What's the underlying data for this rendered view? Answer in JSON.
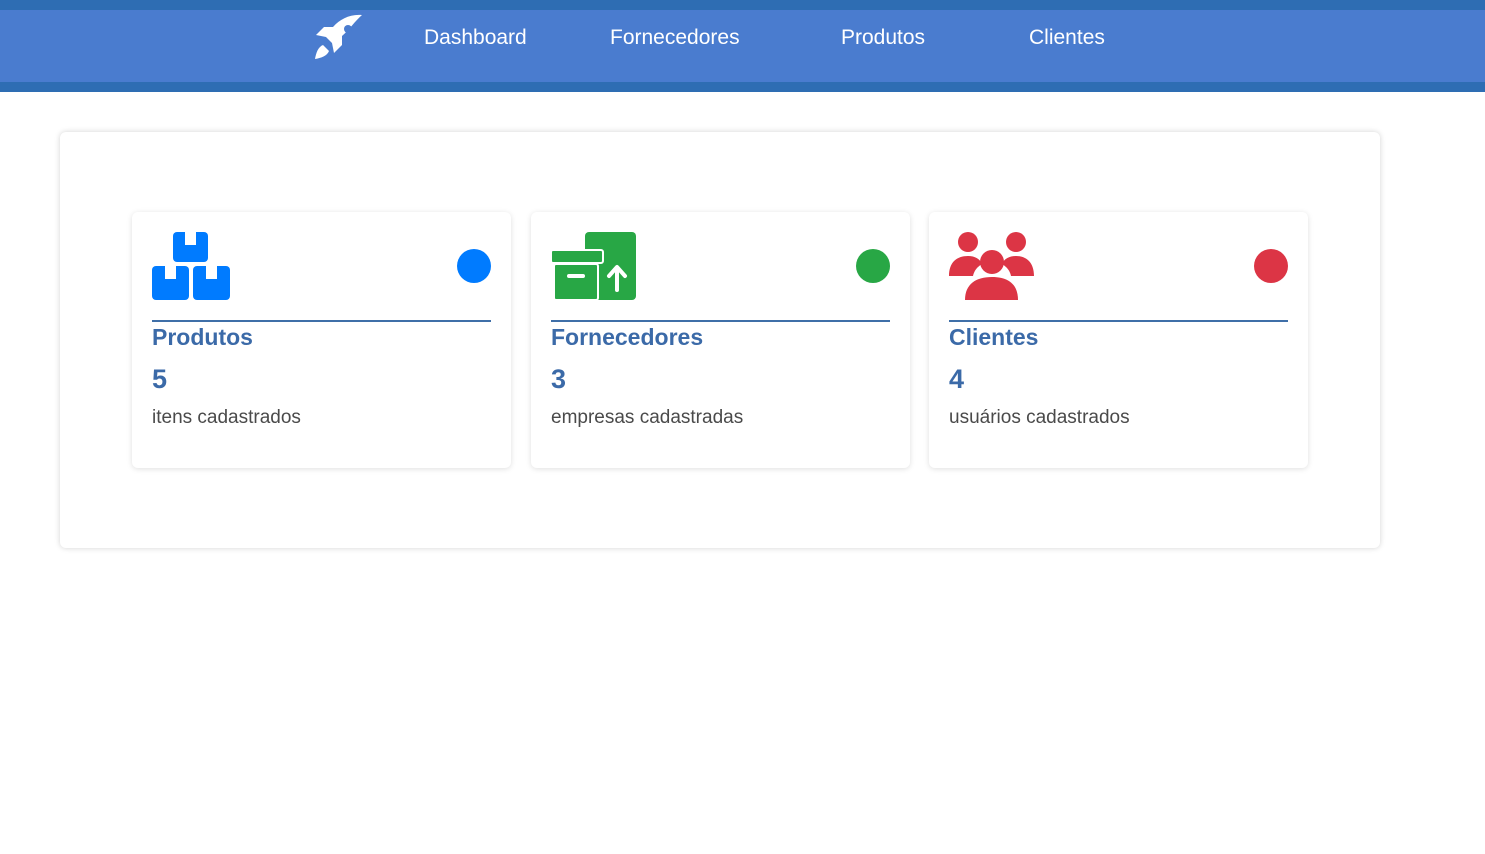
{
  "nav": {
    "logo_icon": "rocket-icon",
    "links": [
      {
        "label": "Dashboard"
      },
      {
        "label": "Fornecedores"
      },
      {
        "label": "Produtos"
      },
      {
        "label": "Clientes"
      }
    ]
  },
  "colors": {
    "navbar": "#4a7ccf",
    "navbar_border": "#2e6db3",
    "title": "#3b6aa8",
    "blue": "#007bff",
    "green": "#28a745",
    "red": "#dc3545"
  },
  "cards": [
    {
      "icon": "boxes-icon",
      "title": "Produtos",
      "count": "5",
      "description": "itens cadastrados",
      "color": "#007bff"
    },
    {
      "icon": "archive-upload-icon",
      "title": "Fornecedores",
      "count": "3",
      "description": "empresas cadastradas",
      "color": "#28a745"
    },
    {
      "icon": "users-icon",
      "title": "Clientes",
      "count": "4",
      "description": "usuários cadastrados",
      "color": "#dc3545"
    }
  ]
}
